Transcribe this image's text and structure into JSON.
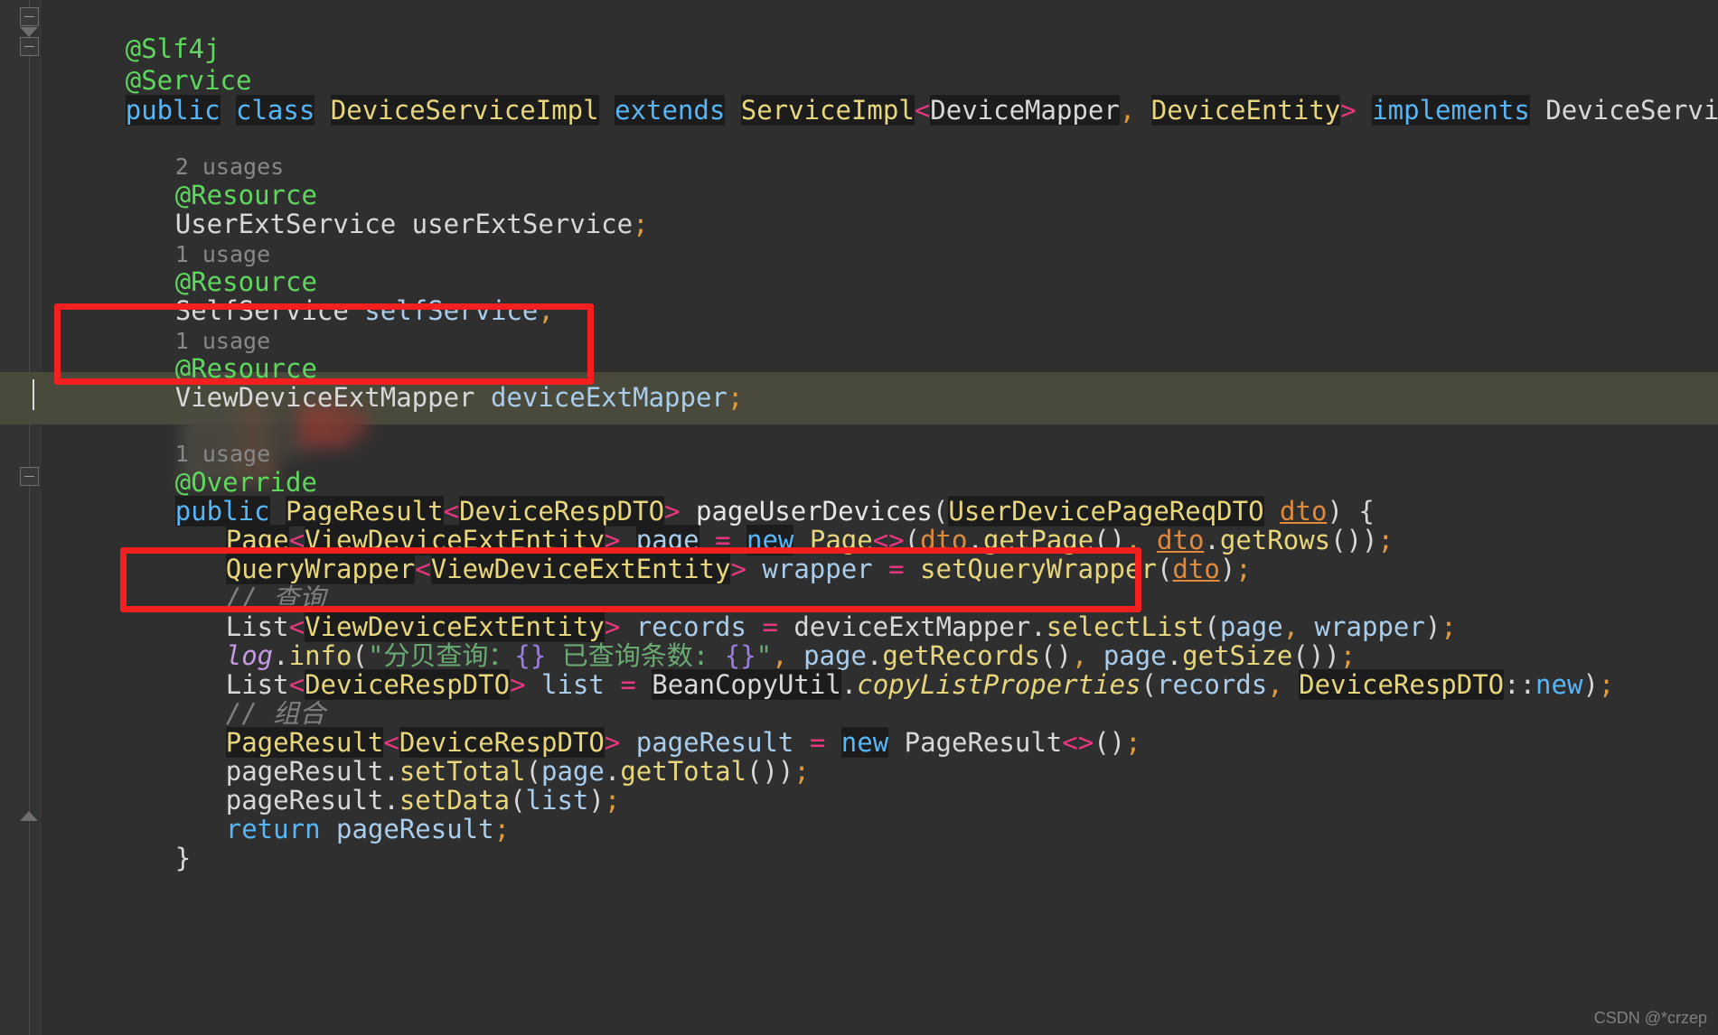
{
  "editor": {
    "language": "java",
    "theme": "darcula",
    "background": "#2f2f2f",
    "gutter_background": "#313335",
    "current_line_color": "#4a4a3c",
    "annotation_box_color": "#f42020",
    "search_highlight_color": "#1c1c1c"
  },
  "gutter": {
    "fold_slf4j": "fold-minus",
    "fold_service": "fold-minus",
    "fold_method": "fold-minus",
    "fold_bottom": "fold-arrow-up"
  },
  "code": {
    "lines": [
      {
        "id": "l1",
        "kind": "annotation",
        "indent": 0,
        "text": "@Slf4j"
      },
      {
        "id": "l2",
        "kind": "annotation",
        "indent": 0,
        "text": "@Service"
      },
      {
        "id": "l3",
        "kind": "declaration",
        "indent": 0,
        "text": "public class DeviceServiceImpl extends ServiceImpl<DeviceMapper, DeviceEntity> implements DeviceService {"
      },
      {
        "id": "l4",
        "kind": "blank",
        "indent": 0,
        "text": ""
      },
      {
        "id": "l5",
        "kind": "usage-hint",
        "indent": 2,
        "text": "2 usages"
      },
      {
        "id": "l6",
        "kind": "annotation",
        "indent": 2,
        "text": "@Resource"
      },
      {
        "id": "l7",
        "kind": "field",
        "indent": 2,
        "text": "UserExtService userExtService;"
      },
      {
        "id": "l8",
        "kind": "usage-hint",
        "indent": 2,
        "text": "1 usage"
      },
      {
        "id": "l9",
        "kind": "annotation",
        "indent": 2,
        "text": "@Resource"
      },
      {
        "id": "l10",
        "kind": "field",
        "indent": 2,
        "text": "SelfService selfService;"
      },
      {
        "id": "l11",
        "kind": "usage-hint",
        "indent": 2,
        "text": "1 usage"
      },
      {
        "id": "l12",
        "kind": "annotation",
        "indent": 2,
        "text": "@Resource"
      },
      {
        "id": "l13",
        "kind": "field",
        "indent": 2,
        "text": "ViewDeviceExtMapper deviceExtMapper;"
      },
      {
        "id": "l14",
        "kind": "caret-line",
        "indent": 0,
        "text": ""
      },
      {
        "id": "l15",
        "kind": "usage-hint",
        "indent": 2,
        "text": "1 usage"
      },
      {
        "id": "l16",
        "kind": "annotation",
        "indent": 2,
        "text": "@Override"
      },
      {
        "id": "l17",
        "kind": "method-signature",
        "indent": 2,
        "text": "public PageResult<DeviceRespDTO> pageUserDevices(UserDevicePageReqDTO dto) {"
      },
      {
        "id": "l18",
        "kind": "statement",
        "indent": 3,
        "text": "Page<ViewDeviceExtEntity> page = new Page<>(dto.getPage(), dto.getRows());"
      },
      {
        "id": "l19",
        "kind": "statement",
        "indent": 3,
        "text": "QueryWrapper<ViewDeviceExtEntity> wrapper = setQueryWrapper(dto);"
      },
      {
        "id": "l20",
        "kind": "comment",
        "indent": 3,
        "text": "// 查询"
      },
      {
        "id": "l21",
        "kind": "statement",
        "indent": 3,
        "text": "List<ViewDeviceExtEntity> records = deviceExtMapper.selectList(page, wrapper);"
      },
      {
        "id": "l22",
        "kind": "statement",
        "indent": 3,
        "text": "log.info(\"分贝查询：{} 已查询条数: {}\", page.getRecords(), page.getSize());"
      },
      {
        "id": "l23",
        "kind": "statement",
        "indent": 3,
        "text": "List<DeviceRespDTO> list = BeanCopyUtil.copyListProperties(records, DeviceRespDTO::new);"
      },
      {
        "id": "l24",
        "kind": "comment",
        "indent": 3,
        "text": "// 组合"
      },
      {
        "id": "l25",
        "kind": "statement",
        "indent": 3,
        "text": "PageResult<DeviceRespDTO> pageResult = new PageResult<>();"
      },
      {
        "id": "l26",
        "kind": "statement",
        "indent": 3,
        "text": "pageResult.setTotal(page.getTotal());"
      },
      {
        "id": "l27",
        "kind": "statement",
        "indent": 3,
        "text": "pageResult.setData(list);"
      },
      {
        "id": "l28",
        "kind": "statement",
        "indent": 3,
        "text": "return pageResult;"
      },
      {
        "id": "l29",
        "kind": "brace",
        "indent": 2,
        "text": "}"
      }
    ],
    "string_literals": [
      "分贝查询：{} 已查询条数: {}"
    ],
    "comments": [
      "// 查询",
      "// 组合"
    ],
    "usage_hints": [
      "2 usages",
      "1 usage",
      "1 usage",
      "1 usage"
    ]
  },
  "annotations": {
    "box_1_label": "highlighted-field-declaration",
    "box_1_contents": "@Resource ViewDeviceExtMapper deviceExtMapper;",
    "box_2_label": "highlighted-query-statement",
    "box_2_contents": "// 查询  List<ViewDeviceExtEntity> records = deviceExtMapper.selectList(page, wrapper);"
  },
  "watermark": {
    "text": "CSDN @*crzep"
  }
}
